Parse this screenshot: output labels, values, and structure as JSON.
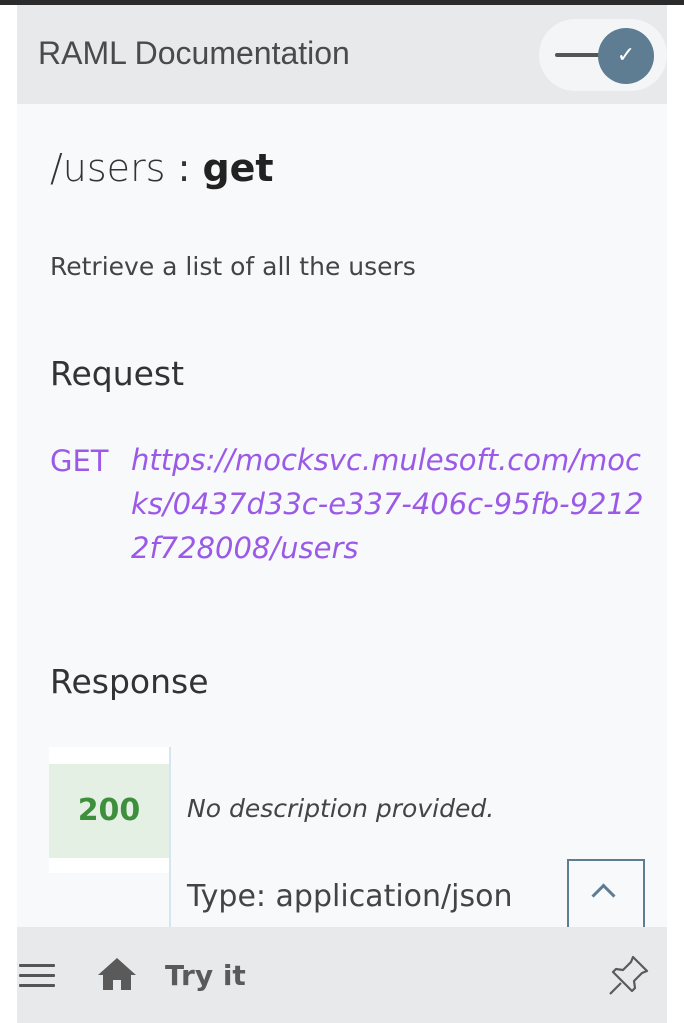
{
  "header": {
    "title": "RAML Documentation",
    "toggle_icon": "✓"
  },
  "endpoint": {
    "path": "/users",
    "separator": " : ",
    "method": "get",
    "description": "Retrieve a list of all the users"
  },
  "request": {
    "heading": "Request",
    "method": "GET",
    "url": "https://mocksvc.mulesoft.com/mocks/0437d33c-e337-406c-95fb-92122f728008/users"
  },
  "response": {
    "heading": "Response",
    "status_code": "200",
    "description": "No description provided.",
    "type": "Type: application/json"
  },
  "footer": {
    "try_label": "Try it",
    "icons": [
      "menu-icon",
      "home-icon",
      "pin-icon"
    ]
  },
  "colors": {
    "accent": "#5e7d92",
    "link": "#9b59e8",
    "success": "#3d8f3d"
  }
}
